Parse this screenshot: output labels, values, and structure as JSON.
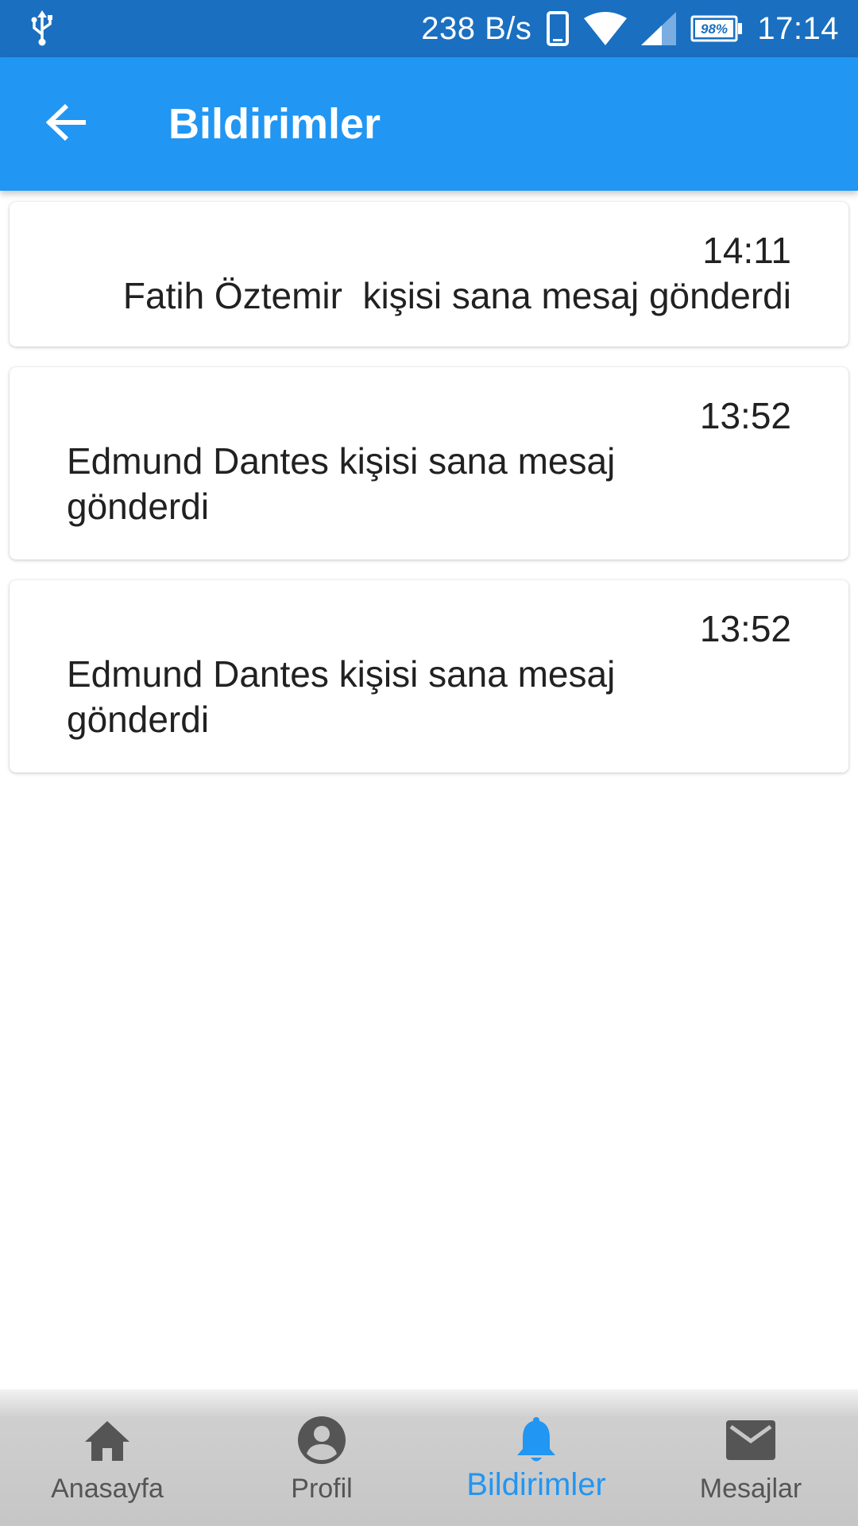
{
  "status_bar": {
    "net_speed": "238 B/s",
    "battery": "98%",
    "time": "17:14",
    "icons": [
      "usb-icon",
      "phone-icon",
      "wifi-icon",
      "signal-icon",
      "battery-icon"
    ]
  },
  "app_bar": {
    "title": "Bildirimler",
    "back_icon": "arrow-back-icon"
  },
  "notifications": [
    {
      "time": "14:11",
      "message": "Fatih Öztemir  kişisi sana mesaj gönderdi"
    },
    {
      "time": "13:52",
      "message": "Edmund Dantes kişisi sana mesaj gönderdi"
    },
    {
      "time": "13:52",
      "message": "Edmund Dantes kişisi sana mesaj gönderdi"
    }
  ],
  "bottom_nav": {
    "items": [
      {
        "label": "Anasayfa",
        "icon": "home-icon"
      },
      {
        "label": "Profil",
        "icon": "account-circle-icon"
      },
      {
        "label": "Bildirimler",
        "icon": "bell-icon",
        "active": true
      },
      {
        "label": "Mesajlar",
        "icon": "mail-icon"
      }
    ]
  },
  "colors": {
    "status_bar": "#1a6fc0",
    "app_bar": "#2196f3",
    "active_nav": "#2196f3",
    "inactive_nav": "#555555",
    "nav_background": "#c6c6c6",
    "text": "#212121"
  }
}
